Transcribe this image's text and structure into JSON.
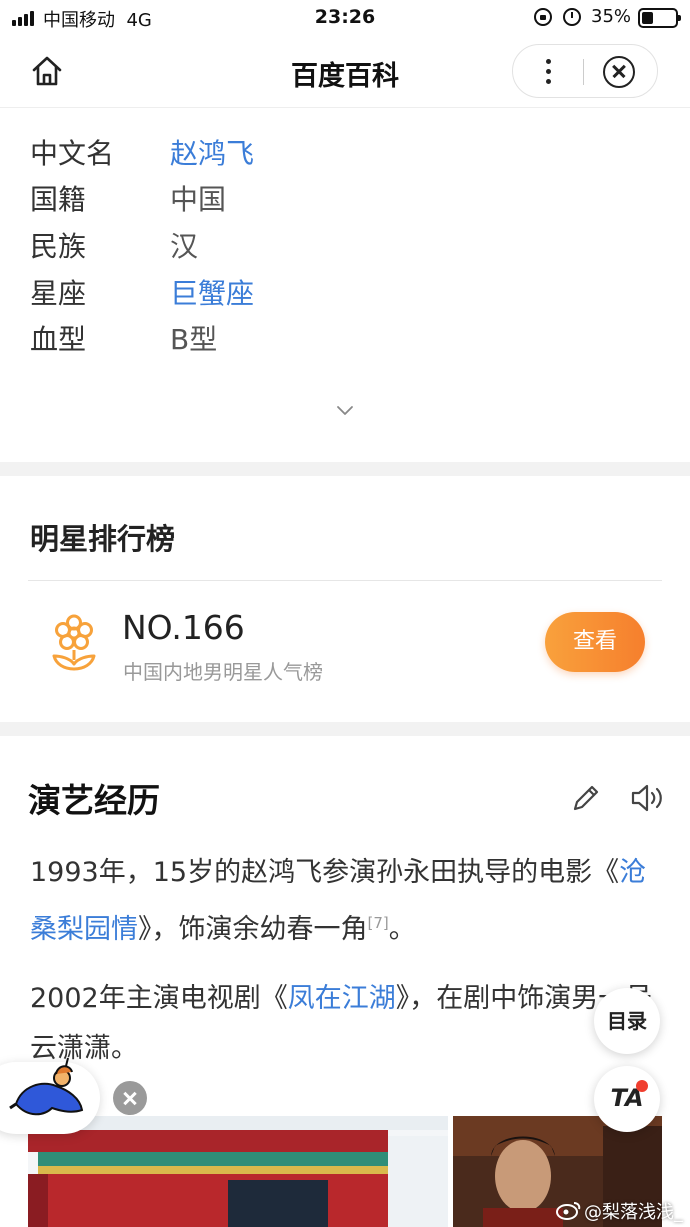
{
  "status_bar": {
    "carrier": "中国移动",
    "network": "4G",
    "time": "23:26",
    "battery_pct": "35%",
    "battery_level": 0.35
  },
  "nav": {
    "title": "百度百科",
    "home_icon": "home-icon",
    "more_icon": "more-vertical-icon",
    "close_icon": "close-circle-icon"
  },
  "info": {
    "rows": [
      {
        "key": "中文名",
        "value": "赵鸿飞",
        "link": true
      },
      {
        "key": "国籍",
        "value": "中国",
        "link": false
      },
      {
        "key": "民族",
        "value": "汉",
        "link": false
      },
      {
        "key": "星座",
        "value": "巨蟹座",
        "link": true
      },
      {
        "key": "血型",
        "value": "B型",
        "link": false
      }
    ],
    "expand_icon": "chevron-down-icon"
  },
  "ranking": {
    "title": "明星排行榜",
    "number": "NO.166",
    "subtitle": "中国内地男明星人气榜",
    "button": "查看",
    "icon": "flower-icon"
  },
  "career": {
    "title": "演艺经历",
    "edit_icon": "pencil-icon",
    "audio_icon": "speaker-icon",
    "para1": {
      "before": "1993年，15岁的赵鸿飞参演孙永田执导的电影《",
      "link": "沧桑梨园情",
      "after": "》，饰演余幼春一角",
      "ref": "[7]",
      "end": "。"
    },
    "para2": {
      "before": "2002年主演电视剧《",
      "link": "凤在江湖",
      "after": "》，在剧中饰演男一号云潇潇。"
    }
  },
  "floating": {
    "toc": "目录",
    "ta": "TA"
  },
  "watermark": "@梨落浅浅_",
  "colors": {
    "link": "#3b7dd8",
    "accent_orange": "#f67f2d",
    "section_gap": "#f2f2f2"
  }
}
